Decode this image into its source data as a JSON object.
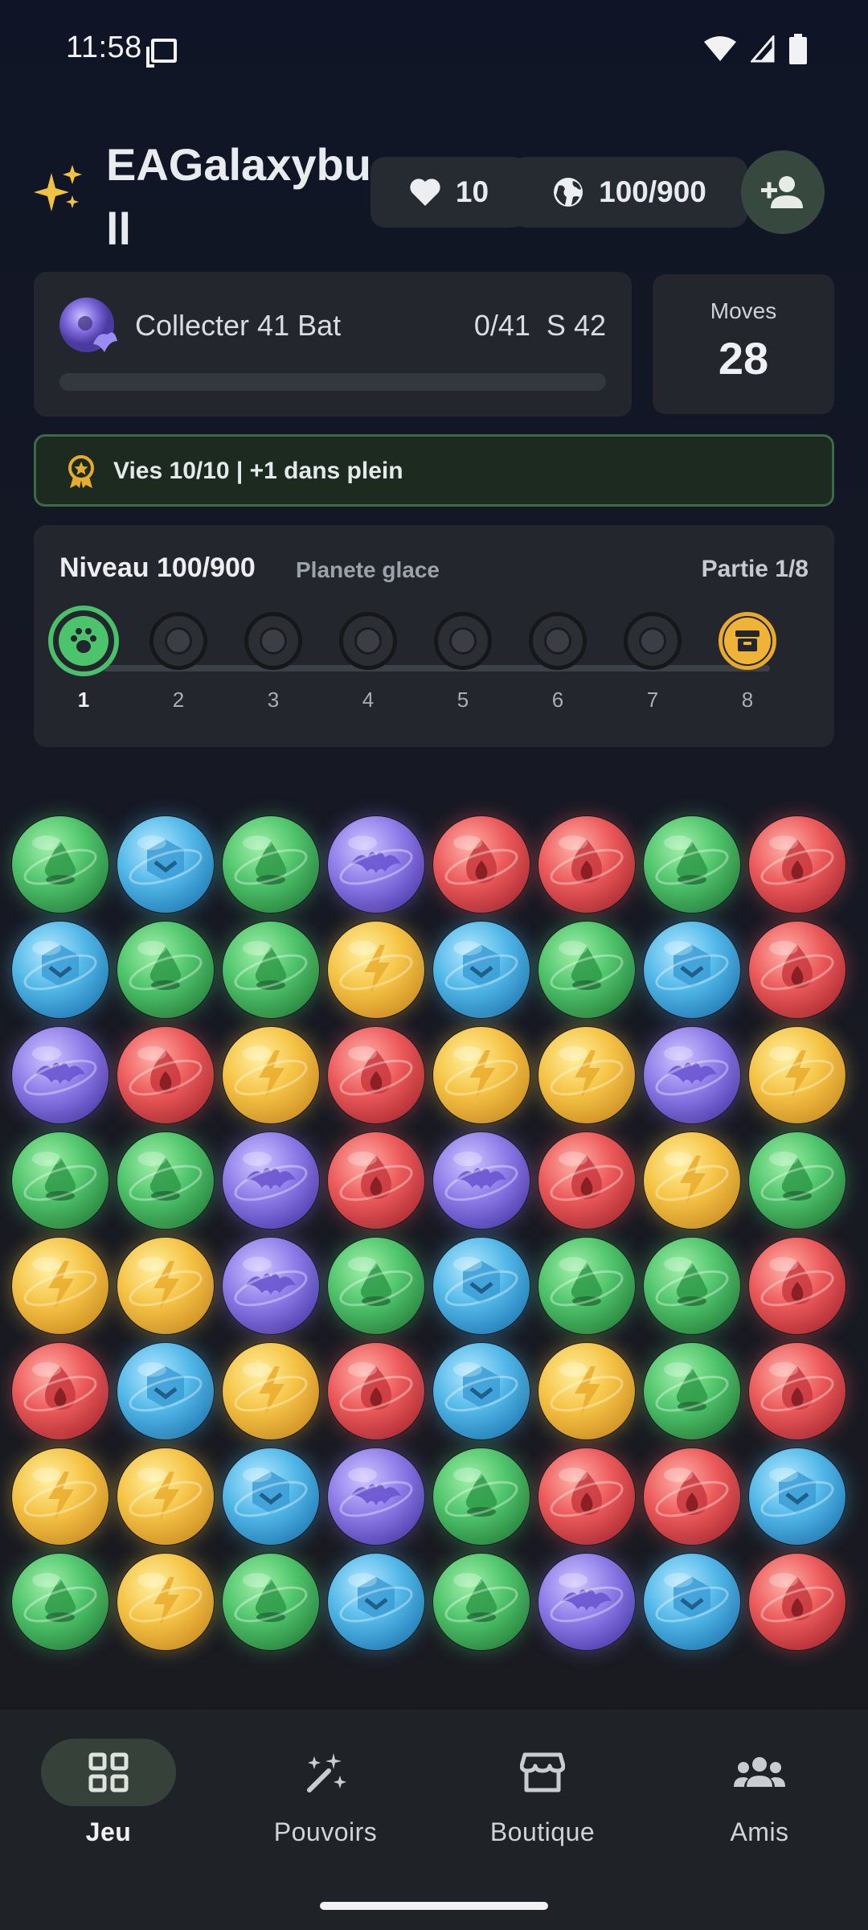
{
  "status_bar": {
    "time": "11:58"
  },
  "header": {
    "username": "EAGalaxybull",
    "hearts": "10",
    "planets": "100/900",
    "icons": {
      "sparkle": "sparkle-icon",
      "heart": "heart-icon",
      "globe": "globe-icon",
      "add_friend": "person-add-icon"
    }
  },
  "objective": {
    "label": "Collecter 41 Bat",
    "progress_text": "0/41  S 42",
    "progress_fraction": 0
  },
  "moves": {
    "label": "Moves",
    "value": "28"
  },
  "lives_banner": {
    "text": "Vies 10/10 | +1 dans plein"
  },
  "level": {
    "title": "Niveau 100/900",
    "subtitle": "Planete glace",
    "part": "Partie 1/8",
    "stages": [
      "1",
      "2",
      "3",
      "4",
      "5",
      "6",
      "7",
      "8"
    ],
    "current_stage": 1
  },
  "board": {
    "rows": [
      [
        "green",
        "blue",
        "green",
        "purple",
        "red",
        "red",
        "green",
        "red"
      ],
      [
        "blue",
        "green",
        "green",
        "yellow",
        "blue",
        "green",
        "blue",
        "red"
      ],
      [
        "purple",
        "red",
        "yellow",
        "red",
        "yellow",
        "yellow",
        "purple",
        "yellow"
      ],
      [
        "green",
        "green",
        "purple",
        "red",
        "purple",
        "red",
        "yellow",
        "green"
      ],
      [
        "yellow",
        "yellow",
        "purple",
        "green",
        "blue",
        "green",
        "green",
        "red"
      ],
      [
        "red",
        "blue",
        "yellow",
        "red",
        "blue",
        "yellow",
        "green",
        "red"
      ],
      [
        "yellow",
        "yellow",
        "blue",
        "purple",
        "green",
        "red",
        "red",
        "blue"
      ],
      [
        "green",
        "yellow",
        "green",
        "blue",
        "green",
        "purple",
        "blue",
        "red"
      ]
    ],
    "colors": {
      "green": "#4fc46b",
      "blue": "#52b8e8",
      "purple": "#8d7ce8",
      "red": "#ec5a5a",
      "yellow": "#f5c344"
    }
  },
  "nav": {
    "items": [
      {
        "label": "Jeu",
        "icon": "grid-icon"
      },
      {
        "label": "Pouvoirs",
        "icon": "magic-wand-icon"
      },
      {
        "label": "Boutique",
        "icon": "storefront-icon"
      },
      {
        "label": "Amis",
        "icon": "group-icon"
      }
    ],
    "active": "Jeu"
  }
}
